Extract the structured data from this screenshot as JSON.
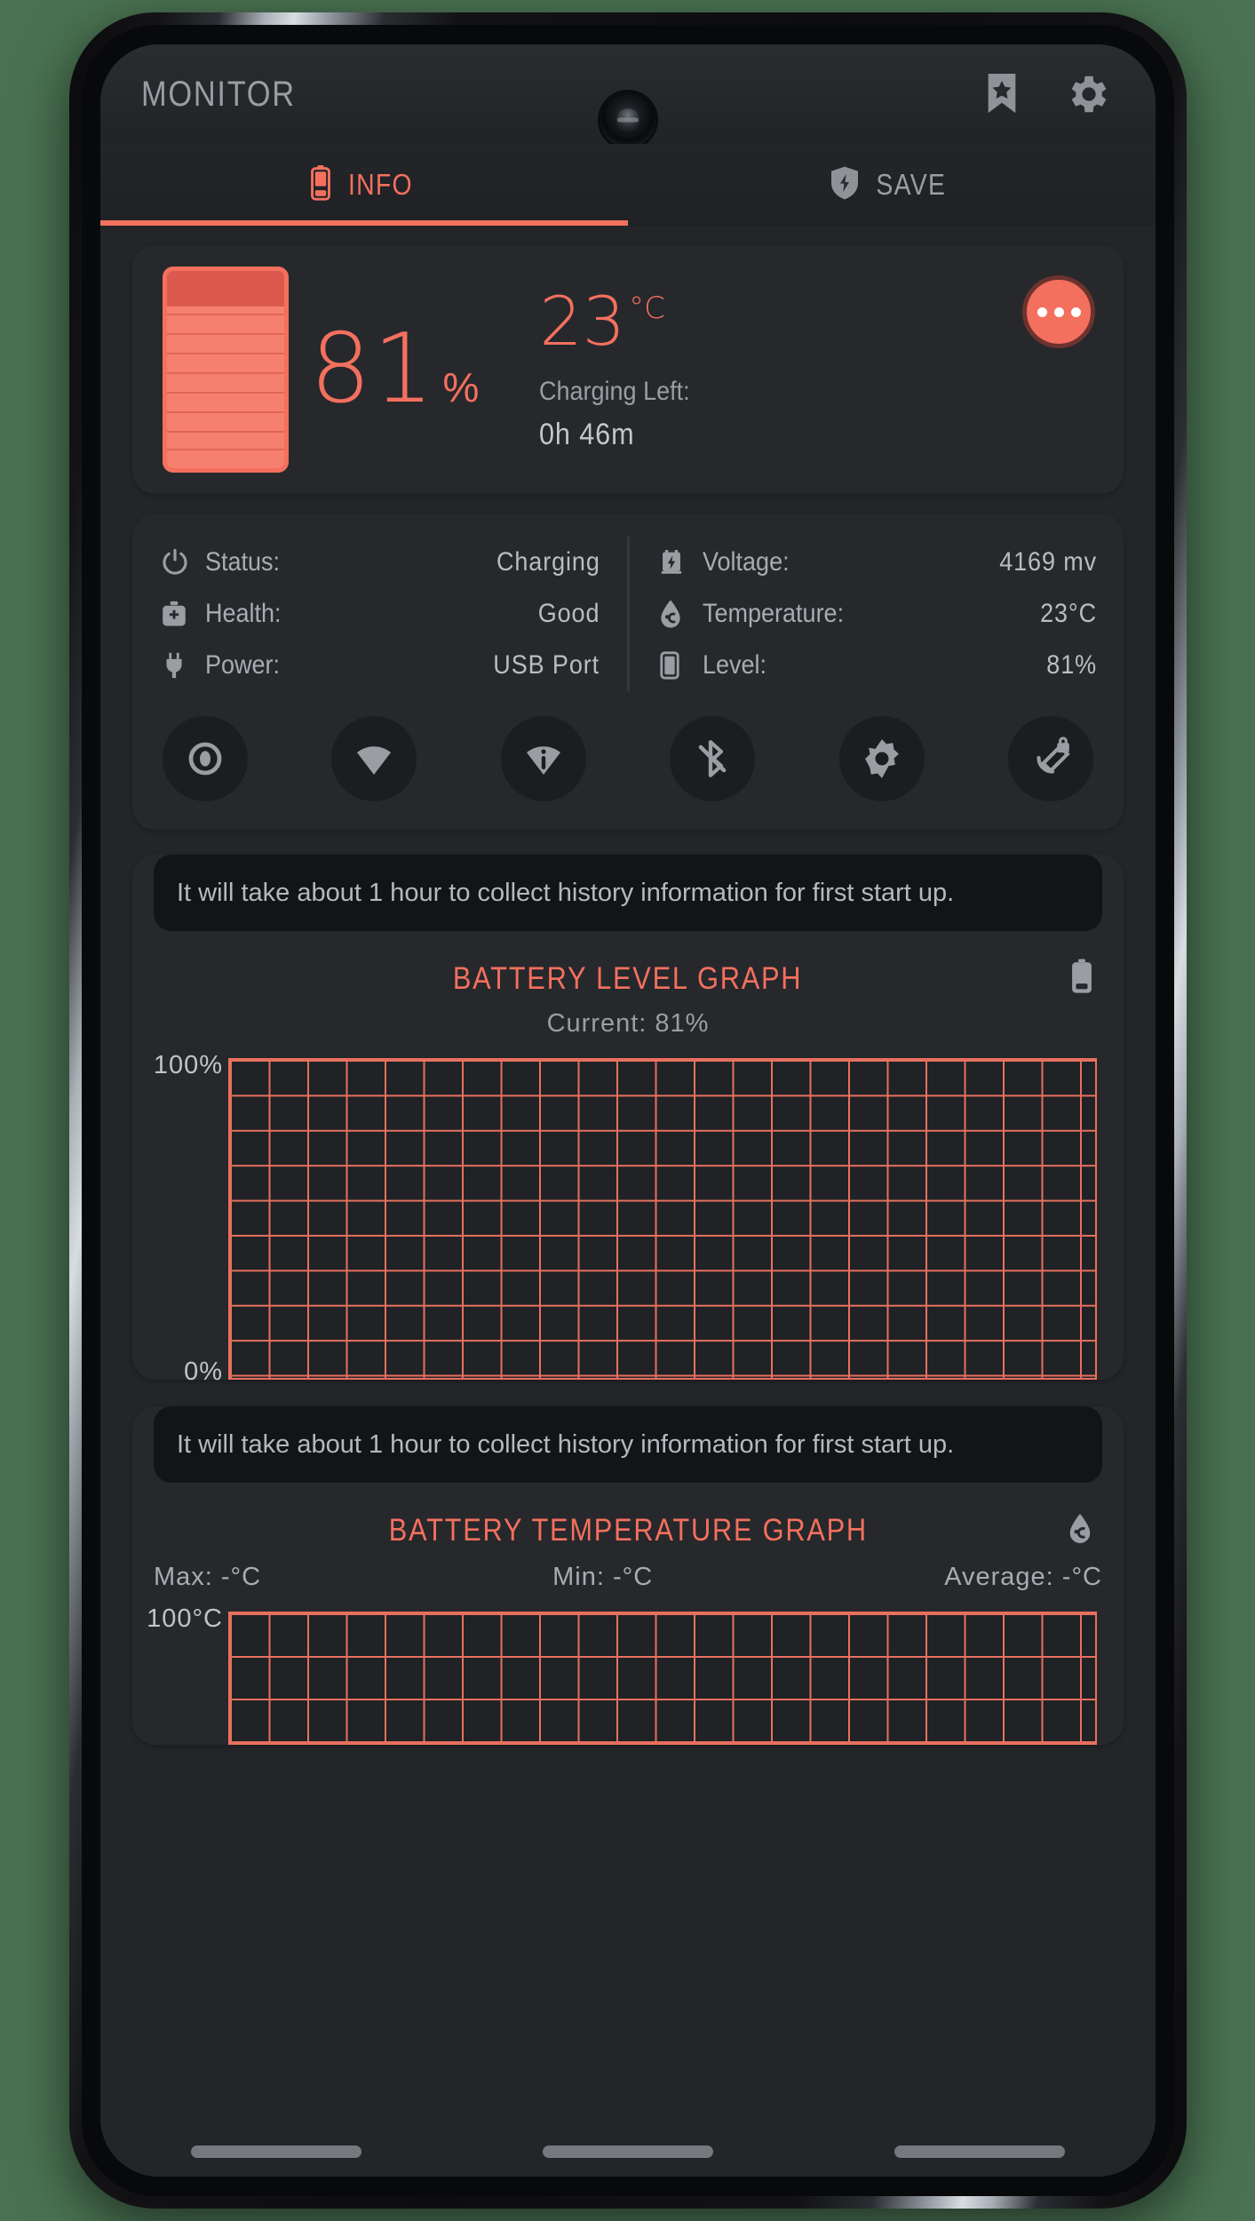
{
  "header": {
    "title": "MONITOR",
    "bookmark_icon": "bookmark-star-icon",
    "settings_icon": "gear-icon"
  },
  "tabs": [
    {
      "label": "INFO",
      "icon": "battery-icon",
      "active": true
    },
    {
      "label": "SAVE",
      "icon": "shield-bolt-icon",
      "active": false
    }
  ],
  "summary": {
    "level_value": "81",
    "level_symbol": "%",
    "temperature_value": "23",
    "temperature_unit": "°C",
    "charging_label": "Charging Left:",
    "charging_value": "0h 46m",
    "menu_icon": "more-dots-icon"
  },
  "stats": {
    "left": [
      {
        "icon": "power-icon",
        "label": "Status:",
        "value": "Charging"
      },
      {
        "icon": "medkit-icon",
        "label": "Health:",
        "value": "Good"
      },
      {
        "icon": "plug-icon",
        "label": "Power:",
        "value": "USB Port"
      }
    ],
    "right": [
      {
        "icon": "battery-bolt-icon",
        "label": "Voltage:",
        "value": "4169 mv"
      },
      {
        "icon": "droplet-temp-icon",
        "label": "Temperature:",
        "value": "23°C"
      },
      {
        "icon": "battery-level-icon",
        "label": "Level:",
        "value": "81%"
      }
    ]
  },
  "toggles": [
    {
      "icon": "eye-icon"
    },
    {
      "icon": "wifi-icon"
    },
    {
      "icon": "wifi-info-icon"
    },
    {
      "icon": "bluetooth-off-icon"
    },
    {
      "icon": "brightness-icon"
    },
    {
      "icon": "rotation-lock-icon"
    }
  ],
  "level_graph": {
    "note": "It will take about 1 hour to collect history information for first start up.",
    "title": "BATTERY LEVEL GRAPH",
    "title_icon": "battery-icon",
    "subtitle": "Current: 81%"
  },
  "temp_graph": {
    "note": "It will take about 1 hour to collect history information for first start up.",
    "title": "BATTERY TEMPERATURE GRAPH",
    "title_icon": "droplet-temp-icon",
    "max_label": "Max: -°C",
    "min_label": "Min: -°C",
    "avg_label": "Average: -°C"
  },
  "colors": {
    "accent": "#f4705e",
    "grid": "#e8705e",
    "muted": "#9a9ea3",
    "card": "#26282c",
    "screen": "#232529"
  },
  "chart_data": [
    {
      "type": "line",
      "title": "BATTERY LEVEL GRAPH",
      "subtitle": "Current: 81%",
      "ylabel": "",
      "xlabel": "",
      "ylim": [
        0,
        100
      ],
      "ytick_labels": [
        "100%",
        "0%"
      ],
      "grid": true,
      "grid_color": "#e8705e",
      "x": [],
      "values": [],
      "annotation": "No history data collected yet — empty grid"
    },
    {
      "type": "line",
      "title": "BATTERY TEMPERATURE GRAPH",
      "subtitle": "Max: -°C   Min: -°C   Average: -°C",
      "ylabel": "",
      "xlabel": "",
      "ylim": [
        0,
        100
      ],
      "ytick_labels": [
        "100°C"
      ],
      "grid": true,
      "grid_color": "#e8705e",
      "x": [],
      "values": [],
      "annotation": "No history data collected yet — empty grid (partially visible)"
    }
  ]
}
